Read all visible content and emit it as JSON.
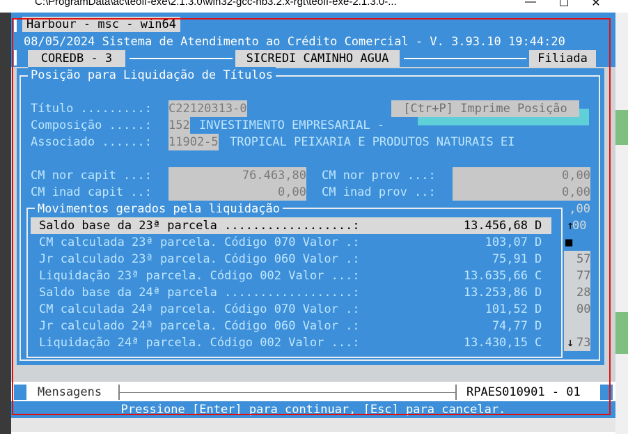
{
  "window": {
    "title": "C:\\ProgramData\\ac\\teoff-exe\\2.1.3.0\\win32-gcc-hb3.2.x-rgt\\teoff-exe-2.1.3.0-...",
    "minimize": "—",
    "maximize": "☐",
    "close": "✕"
  },
  "app": {
    "tab": "Harbour - msc - win64",
    "header": "08/05/2024 Sistema de Atendimento ao Crédito Comercial - V. 3.93.10 19:44:20",
    "coredb": "COREDB - 3",
    "branch": "SICREDI CAMINHO AGUA",
    "filiada": "Filiada"
  },
  "panel": {
    "title": "Posição para Liquidação de Títulos",
    "titulo_label": "Título .........:",
    "titulo_value": "C22120313-0",
    "print_button": "[Ctr+P] Imprime Posição",
    "composicao_label": "Composição .....:",
    "composicao_code": "152",
    "composicao_desc": "INVESTIMENTO EMPRESARIAL -",
    "associado_label": "Associado ......:",
    "associado_code": "11902-5",
    "associado_name": "TROPICAL PEIXARIA E PRODUTOS NATURAIS EI",
    "cm_nor_capit_label": "CM nor capit ...:",
    "cm_nor_capit_value": "76.463,80",
    "cm_nor_prov_label": "CM nor prov ...:",
    "cm_nor_prov_value": "0,00",
    "cm_inad_capit_label": "CM inad capit ..:",
    "cm_inad_capit_value": "0,00",
    "cm_inad_prov_label": "CM inad prov ..:",
    "cm_inad_prov_value": "0,00",
    "behind_values": [
      ",00",
      "00",
      "",
      "57",
      "77",
      "28",
      "00",
      "",
      "73"
    ]
  },
  "movements": {
    "title": "Movimentos gerados pela liquidação",
    "scroll_up": "↑",
    "scroll_thumb": "■",
    "scroll_down": "↓",
    "rows": [
      {
        "label": "Saldo base da 23ª parcela ..................:",
        "value": "13.456,68",
        "dc": "D"
      },
      {
        "label": "CM calculada 23ª parcela. Código 070 Valor .:",
        "value": "103,07",
        "dc": "D"
      },
      {
        "label": "Jr calculado 23ª parcela. Código 060 Valor .:",
        "value": "75,91",
        "dc": "D"
      },
      {
        "label": "Liquidação 23ª parcela. Código 002 Valor ...:",
        "value": "13.635,66",
        "dc": "C"
      },
      {
        "label": "Saldo base da 24ª parcela ..................:",
        "value": "13.253,86",
        "dc": "D"
      },
      {
        "label": "CM calculada 24ª parcela. Código 070 Valor .:",
        "value": "101,52",
        "dc": "D"
      },
      {
        "label": "Jr calculado 24ª parcela. Código 060 Valor .:",
        "value": "74,77",
        "dc": "D"
      },
      {
        "label": "Liquidação 24ª parcela. Código 002 Valor ...:",
        "value": "13.430,15",
        "dc": "C"
      }
    ]
  },
  "status": {
    "mensagens": "Mensagens",
    "program": "RPAES010901 - 01",
    "hint": "Pressione [Enter] para continuar, [Esc] para cancelar."
  },
  "colors": {
    "console_bg": "#3c8fd8",
    "field_bg": "#c8c8c8",
    "selection_bg": "#d9d9d9",
    "frame_red": "#e01010"
  }
}
